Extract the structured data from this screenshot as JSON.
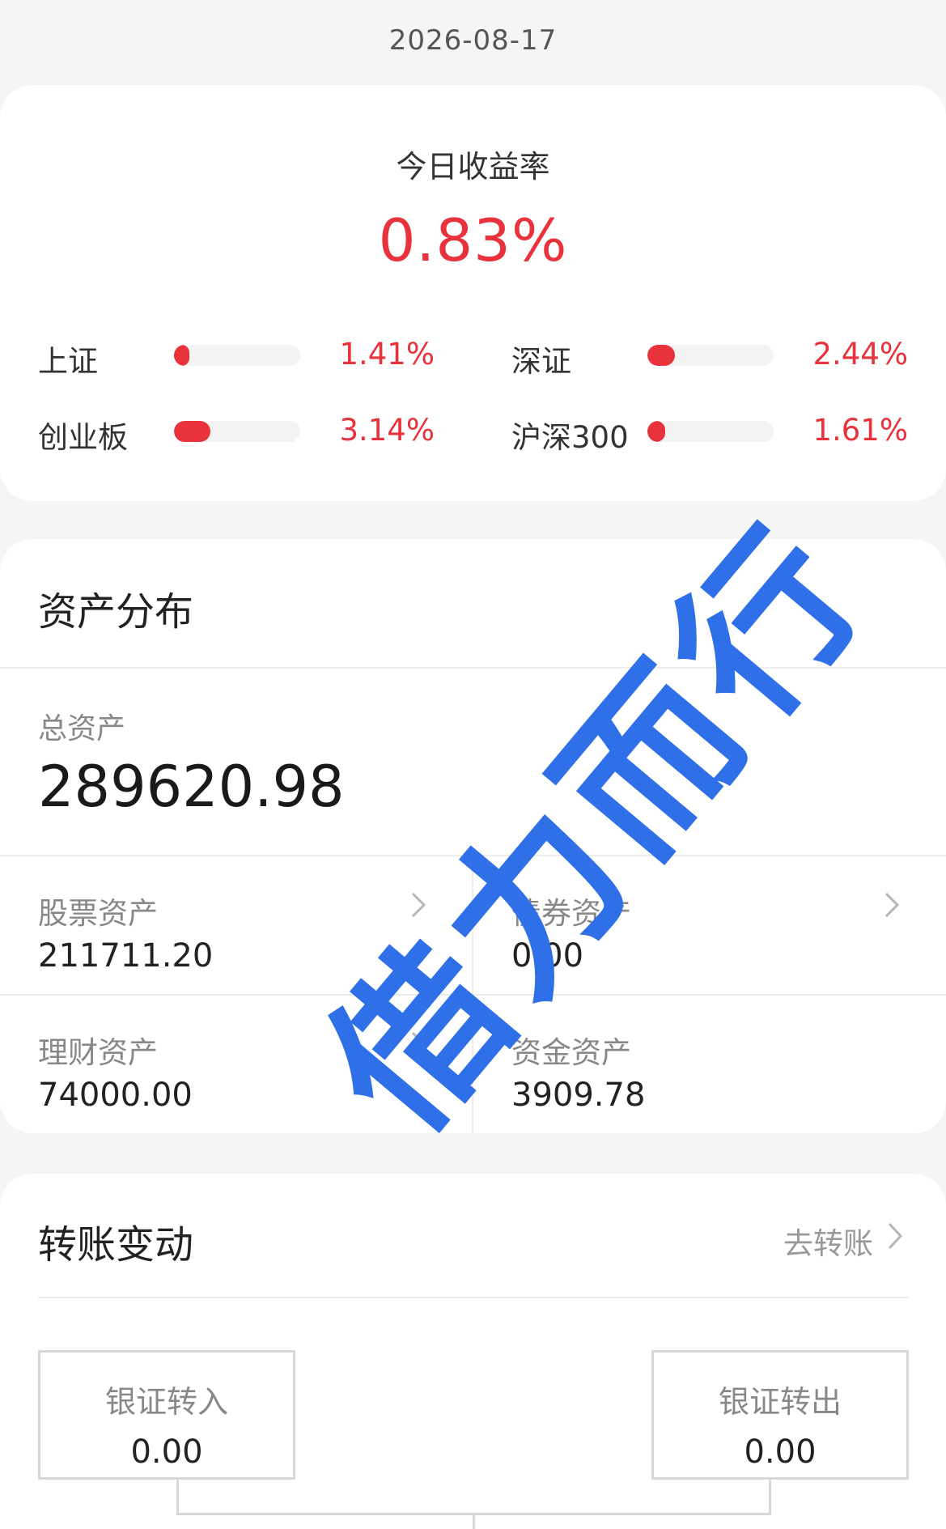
{
  "date": "2026-08-17",
  "today_return": {
    "label": "今日收益率",
    "value": "0.83%",
    "indices": [
      {
        "name": "上证",
        "value": "1.41%",
        "level": 0.12
      },
      {
        "name": "深证",
        "value": "2.44%",
        "level": 0.22
      },
      {
        "name": "创业板",
        "value": "3.14%",
        "level": 0.29
      },
      {
        "name": "沪深300",
        "value": "1.61%",
        "level": 0.14
      }
    ]
  },
  "assets": {
    "title": "资产分布",
    "total_label": "总资产",
    "total_value": "289620.98",
    "items": [
      {
        "label": "股票资产",
        "value": "211711.20"
      },
      {
        "label": "债券资产",
        "value": "0.00"
      },
      {
        "label": "理财资产",
        "value": "74000.00"
      },
      {
        "label": "资金资产",
        "value": "3909.78"
      }
    ]
  },
  "transfers": {
    "title": "转账变动",
    "goto_label": "去转账",
    "in_label": "银证转入",
    "in_value": "0.00",
    "out_label": "银证转出",
    "out_value": "0.00"
  },
  "watermark": "借力而行",
  "colors": {
    "up": "#e8323c",
    "watermark": "#2f6fe8"
  }
}
